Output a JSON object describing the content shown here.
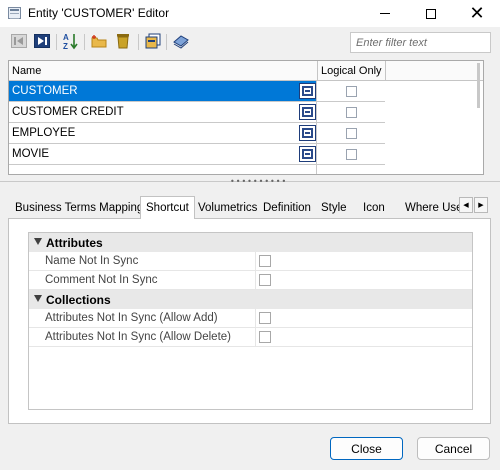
{
  "window": {
    "title": "Entity 'CUSTOMER' Editor",
    "minimize_icon": "minimize-icon",
    "maximize_icon": "maximize-icon",
    "close_icon": "close-icon"
  },
  "toolbar": {
    "icons": [
      "previous-icon",
      "next-icon",
      "sort-icon",
      "new-folder-icon",
      "delete-icon",
      "properties-icon",
      "model-icon"
    ],
    "filter_placeholder": "Enter filter text"
  },
  "grid": {
    "columns": [
      "Name",
      "Logical Only"
    ],
    "rows": [
      {
        "name": "CUSTOMER",
        "selected": true,
        "logical_only": false
      },
      {
        "name": "CUSTOMER CREDIT",
        "selected": false,
        "logical_only": false
      },
      {
        "name": "EMPLOYEE",
        "selected": false,
        "logical_only": false
      },
      {
        "name": "MOVIE",
        "selected": false,
        "logical_only": false
      }
    ],
    "selection_color": "#0078d7"
  },
  "tabs": {
    "items": [
      "Business Terms Mapping",
      "Shortcut",
      "Volumetrics",
      "Definition",
      "Style",
      "Icon",
      "Where Use"
    ],
    "active": "Shortcut"
  },
  "properties": {
    "groups": [
      {
        "label": "Attributes",
        "items": [
          {
            "label": "Name Not In Sync",
            "checked": false
          },
          {
            "label": "Comment Not In Sync",
            "checked": false
          }
        ]
      },
      {
        "label": "Collections",
        "items": [
          {
            "label": "Attributes Not In Sync (Allow Add)",
            "checked": false
          },
          {
            "label": "Attributes Not In Sync (Allow Delete)",
            "checked": false
          }
        ]
      }
    ]
  },
  "buttons": {
    "close": "Close",
    "cancel": "Cancel"
  },
  "colors": {
    "accent": "#0067c0"
  }
}
